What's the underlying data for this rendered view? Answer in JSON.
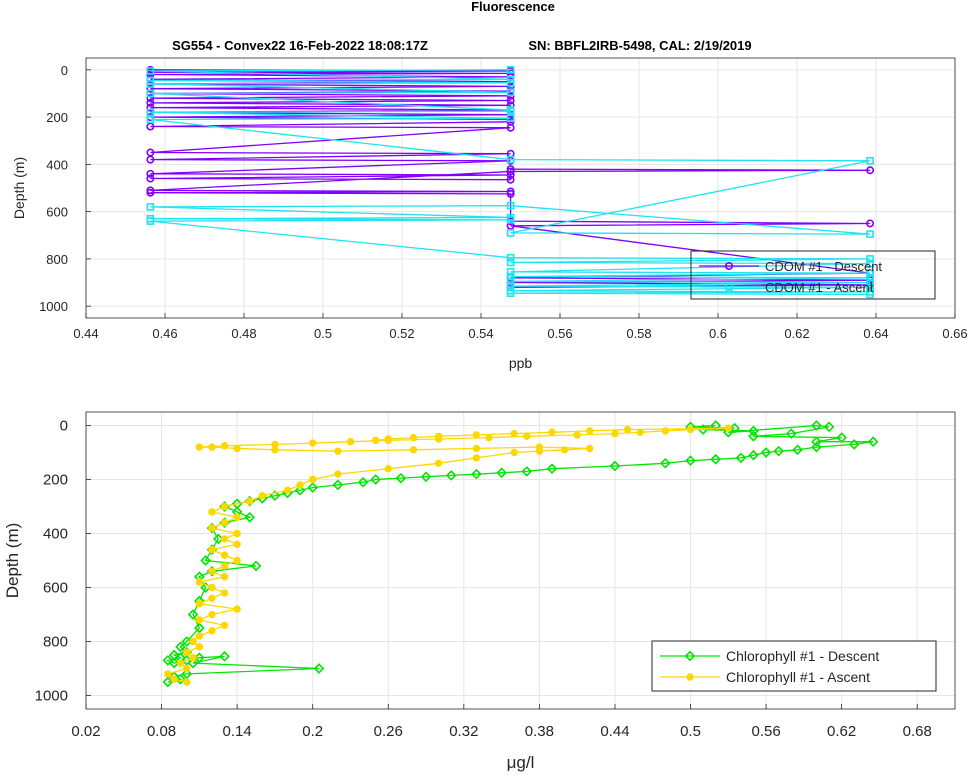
{
  "figure": {
    "title": "Fluorescence",
    "subtitle_left": "SG554 - Convex22 16-Feb-2022 18:08:17Z",
    "subtitle_right": "SN: BBFL2IRB-5498, CAL: 2/19/2019"
  },
  "chart_data": [
    {
      "type": "line",
      "xlabel": "ppb",
      "ylabel": "Depth (m)",
      "xlim": [
        0.44,
        0.66
      ],
      "ylim": [
        1050,
        -50
      ],
      "y_reversed": true,
      "xticks": [
        "0.44",
        "0.46",
        "0.48",
        "0.5",
        "0.52",
        "0.54",
        "0.56",
        "0.58",
        "0.6",
        "0.62",
        "0.64",
        "0.66"
      ],
      "xtick_values": [
        0.44,
        0.46,
        0.48,
        0.5,
        0.52,
        0.54,
        0.56,
        0.58,
        0.6,
        0.62,
        0.64,
        0.66
      ],
      "yticks": [
        "0",
        "200",
        "400",
        "600",
        "800",
        "1000"
      ],
      "ytick_values": [
        0,
        200,
        400,
        600,
        800,
        1000
      ],
      "grid": true,
      "legend_position": "bottom-right",
      "series": [
        {
          "name": "CDOM #1 - Descent",
          "color": "#8000ff",
          "marker": "circle",
          "x": [
            0.4563,
            0.5475,
            0.4563,
            0.5475,
            0.4563,
            0.5475,
            0.4563,
            0.5475,
            0.4563,
            0.5475,
            0.4563,
            0.5475,
            0.4563,
            0.5475,
            0.4563,
            0.5475,
            0.4563,
            0.5475,
            0.4563,
            0.5475,
            0.4563,
            0.5475,
            0.4563,
            0.5475,
            0.5475,
            0.4563,
            0.5475,
            0.4563,
            0.5475,
            0.4563,
            0.5475,
            0.4563,
            0.5475,
            0.4563,
            0.5475,
            0.5475,
            0.6385,
            0.5475,
            0.4563,
            0.5475,
            0.4563,
            0.5475,
            0.5475,
            0.6385,
            0.5475,
            0.6385,
            0.5475,
            0.6385,
            0.5475,
            0.6385,
            0.5475
          ],
          "y": [
            0,
            5,
            10,
            15,
            20,
            30,
            40,
            50,
            60,
            70,
            80,
            90,
            100,
            110,
            120,
            130,
            140,
            150,
            160,
            170,
            180,
            190,
            200,
            210,
            220,
            240,
            245,
            350,
            355,
            380,
            385,
            440,
            445,
            460,
            465,
            420,
            425,
            430,
            510,
            515,
            520,
            525,
            640,
            650,
            660,
            860,
            880,
            890,
            900,
            910,
            920
          ]
        },
        {
          "name": "CDOM #1 - Ascent",
          "color": "#1ee3f0",
          "marker": "square",
          "x": [
            0.6385,
            0.5475,
            0.6385,
            0.5475,
            0.6385,
            0.5475,
            0.6385,
            0.5475,
            0.6385,
            0.5475,
            0.6385,
            0.5475,
            0.6385,
            0.5475,
            0.6385,
            0.5475,
            0.4563,
            0.5475,
            0.4563,
            0.5475,
            0.4563,
            0.5475,
            0.6385,
            0.5475,
            0.6385,
            0.5475,
            0.4563,
            0.5475,
            0.4563,
            0.5475,
            0.5475,
            0.4563,
            0.5475,
            0.4563,
            0.5475,
            0.4563,
            0.5475,
            0.4563,
            0.5475
          ],
          "y": [
            950,
            945,
            940,
            935,
            920,
            915,
            900,
            895,
            880,
            875,
            860,
            855,
            820,
            815,
            800,
            795,
            640,
            635,
            630,
            625,
            580,
            575,
            695,
            690,
            385,
            380,
            210,
            205,
            180,
            175,
            170,
            100,
            95,
            60,
            55,
            45,
            40,
            5,
            0
          ]
        }
      ]
    },
    {
      "type": "line",
      "xlabel": "μg/l",
      "ylabel": "Depth (m)",
      "xlim": [
        0.02,
        0.71
      ],
      "ylim": [
        1050,
        -50
      ],
      "y_reversed": true,
      "xticks": [
        "0.02",
        "0.08",
        "0.14",
        "0.2",
        "0.26",
        "0.32",
        "0.38",
        "0.44",
        "0.5",
        "0.56",
        "0.62",
        "0.68"
      ],
      "xtick_values": [
        0.02,
        0.08,
        0.14,
        0.2,
        0.26,
        0.32,
        0.38,
        0.44,
        0.5,
        0.56,
        0.62,
        0.68
      ],
      "yticks": [
        "0",
        "200",
        "400",
        "600",
        "800",
        "1000"
      ],
      "ytick_values": [
        0,
        200,
        400,
        600,
        800,
        1000
      ],
      "grid": true,
      "legend_position": "bottom-right",
      "series": [
        {
          "name": "Chlorophyll #1 - Descent",
          "color": "#00e600",
          "marker": "diamond",
          "x": [
            0.52,
            0.5,
            0.535,
            0.51,
            0.55,
            0.53,
            0.6,
            0.61,
            0.58,
            0.55,
            0.62,
            0.6,
            0.645,
            0.63,
            0.6,
            0.585,
            0.57,
            0.56,
            0.55,
            0.54,
            0.52,
            0.5,
            0.48,
            0.44,
            0.39,
            0.37,
            0.35,
            0.33,
            0.31,
            0.29,
            0.27,
            0.25,
            0.24,
            0.22,
            0.2,
            0.19,
            0.18,
            0.17,
            0.16,
            0.15,
            0.14,
            0.13,
            0.14,
            0.15,
            0.13,
            0.12,
            0.125,
            0.12,
            0.115,
            0.155,
            0.12,
            0.11,
            0.115,
            0.11,
            0.105,
            0.11,
            0.1,
            0.095,
            0.1,
            0.09,
            0.095,
            0.085,
            0.09,
            0.1,
            0.11,
            0.13,
            0.105,
            0.205,
            0.1,
            0.09,
            0.095,
            0.085
          ],
          "y": [
            0,
            5,
            10,
            15,
            20,
            25,
            0,
            5,
            30,
            40,
            45,
            60,
            60,
            70,
            80,
            90,
            95,
            100,
            110,
            120,
            125,
            130,
            140,
            150,
            160,
            170,
            175,
            180,
            185,
            190,
            195,
            200,
            210,
            220,
            230,
            240,
            250,
            260,
            270,
            280,
            290,
            300,
            320,
            340,
            360,
            380,
            420,
            460,
            500,
            520,
            540,
            560,
            600,
            650,
            700,
            750,
            800,
            820,
            840,
            850,
            860,
            870,
            880,
            870,
            860,
            855,
            880,
            900,
            920,
            930,
            940,
            950
          ]
        },
        {
          "name": "Chlorophyll #1 - Ascent",
          "color": "#ffd700",
          "marker": "circle",
          "x": [
            0.1,
            0.09,
            0.085,
            0.1,
            0.095,
            0.105,
            0.1,
            0.11,
            0.105,
            0.11,
            0.12,
            0.13,
            0.11,
            0.12,
            0.14,
            0.11,
            0.12,
            0.13,
            0.12,
            0.11,
            0.13,
            0.12,
            0.13,
            0.14,
            0.13,
            0.12,
            0.14,
            0.13,
            0.14,
            0.12,
            0.13,
            0.14,
            0.12,
            0.13,
            0.15,
            0.16,
            0.18,
            0.19,
            0.2,
            0.22,
            0.26,
            0.3,
            0.33,
            0.36,
            0.38,
            0.4,
            0.42,
            0.38,
            0.33,
            0.28,
            0.22,
            0.17,
            0.14,
            0.12,
            0.11,
            0.13,
            0.17,
            0.2,
            0.23,
            0.26,
            0.3,
            0.34,
            0.37,
            0.41,
            0.44,
            0.46,
            0.48,
            0.5,
            0.53,
            0.45,
            0.42,
            0.39,
            0.36,
            0.33,
            0.3,
            0.28,
            0.26,
            0.25
          ],
          "y": [
            950,
            940,
            920,
            900,
            880,
            860,
            840,
            820,
            800,
            780,
            760,
            740,
            720,
            700,
            680,
            660,
            640,
            620,
            600,
            580,
            560,
            540,
            520,
            500,
            480,
            460,
            440,
            420,
            400,
            380,
            360,
            340,
            320,
            300,
            280,
            260,
            240,
            220,
            200,
            180,
            160,
            140,
            120,
            100,
            95,
            90,
            85,
            80,
            85,
            90,
            95,
            90,
            85,
            80,
            80,
            75,
            70,
            65,
            60,
            55,
            50,
            45,
            40,
            35,
            30,
            25,
            20,
            15,
            10,
            15,
            20,
            25,
            30,
            35,
            40,
            45,
            50,
            55
          ]
        }
      ]
    }
  ]
}
